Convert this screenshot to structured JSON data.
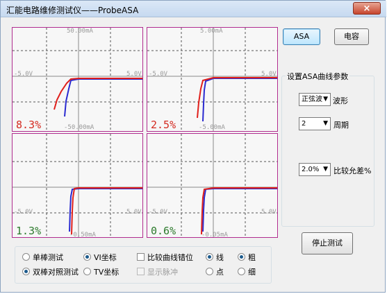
{
  "window": {
    "title": "汇能电路维修测试仪——ProbeASA",
    "close_glyph": "×"
  },
  "panels": [
    {
      "top_label": "50.00mA",
      "left_label": "-5.0V",
      "right_label": "5.0V",
      "bottom_label": "-50.00mA",
      "percent": "8.3%",
      "percent_color": "red"
    },
    {
      "top_label": "5.00mA",
      "left_label": "-5.0V",
      "right_label": "5.0V",
      "bottom_label": "-5.00mA",
      "percent": "2.5%",
      "percent_color": "red"
    },
    {
      "top_label": "",
      "left_label": "-5.0V",
      "right_label": "5.0V",
      "bottom_label": "-0.50mA",
      "percent": "1.3%",
      "percent_color": "green"
    },
    {
      "top_label": "",
      "left_label": "-5.0V",
      "right_label": "5.0V",
      "bottom_label": "-0.05mA",
      "percent": "0.6%",
      "percent_color": "green"
    }
  ],
  "buttons": {
    "asa": "ASA",
    "capacitance": "电容",
    "stop_test": "停止测试"
  },
  "settings": {
    "group_title": "设置ASA曲线参数",
    "waveform_value": "正弦波",
    "waveform_label": "波形",
    "period_value": "2",
    "period_label": "周期",
    "tolerance_value": "2.0%",
    "tolerance_label": "比较允差%"
  },
  "options": {
    "single_test": "单棒测试",
    "dual_compare": "双棒对照测试",
    "vi_coord": "VI坐标",
    "tv_coord": "TV坐标",
    "compare_mismatch": "比较曲线错位",
    "show_pulse": "显示脉冲",
    "line": "线",
    "dot": "点",
    "thick": "粗",
    "thin": "细"
  },
  "colors": {
    "panel_border": "#b02c8f",
    "curve_red": "#e0201c",
    "curve_blue": "#2a2ad0"
  }
}
